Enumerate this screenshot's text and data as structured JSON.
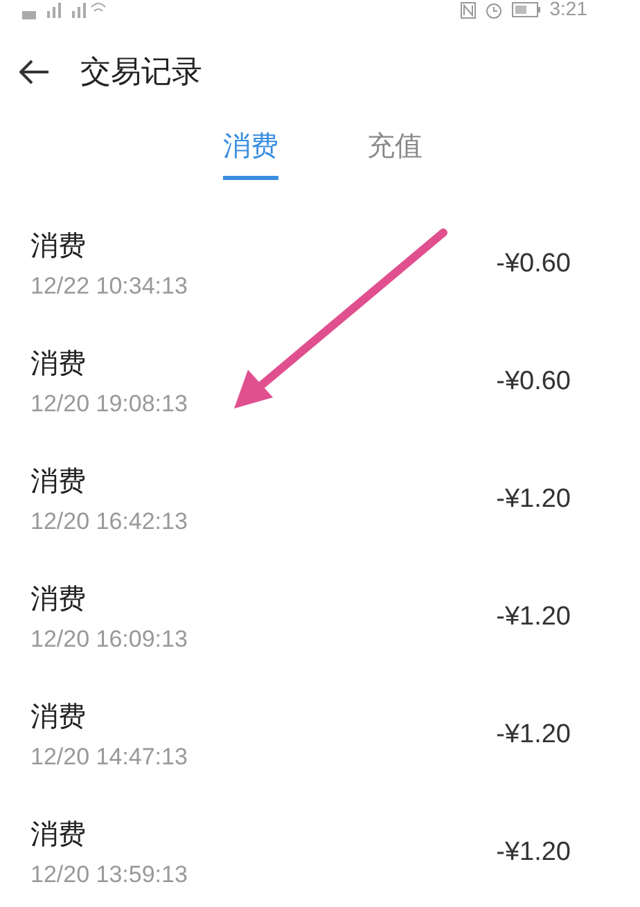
{
  "status_bar": {
    "time": "3:21"
  },
  "header": {
    "title": "交易记录"
  },
  "tabs": [
    {
      "label": "消费",
      "selected": true
    },
    {
      "label": "充值",
      "selected": false
    }
  ],
  "transactions": [
    {
      "type": "消费",
      "time": "12/22 10:34:13",
      "amount": "-¥0.60"
    },
    {
      "type": "消费",
      "time": "12/20 19:08:13",
      "amount": "-¥0.60"
    },
    {
      "type": "消费",
      "time": "12/20 16:42:13",
      "amount": "-¥1.20"
    },
    {
      "type": "消费",
      "time": "12/20 16:09:13",
      "amount": "-¥1.20"
    },
    {
      "type": "消费",
      "time": "12/20 14:47:13",
      "amount": "-¥1.20"
    },
    {
      "type": "消费",
      "time": "12/20 13:59:13",
      "amount": "-¥1.20"
    }
  ]
}
